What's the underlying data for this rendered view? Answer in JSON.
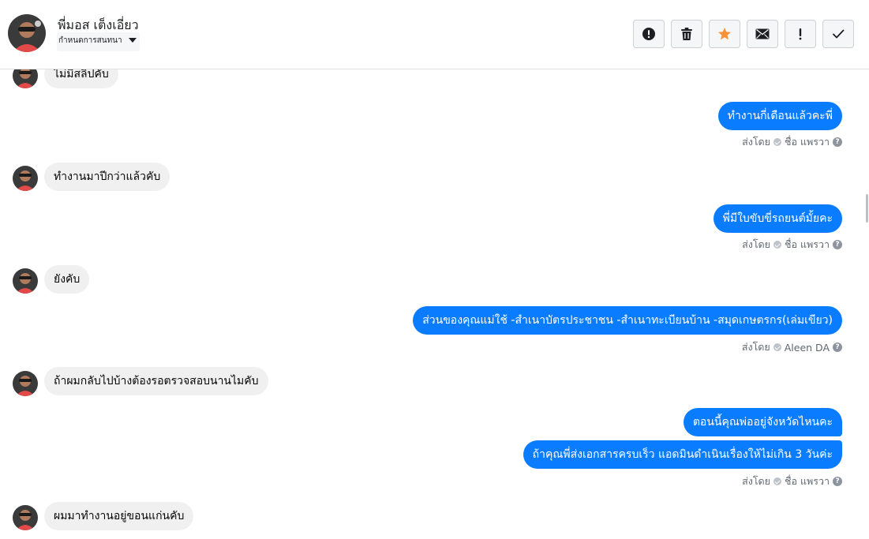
{
  "header": {
    "contact_name": "พี่มอส เต็งเอี่ยว",
    "assign_label": "กำหนดการสนทนา"
  },
  "toolbar": [
    {
      "name": "report-spam-button",
      "icon": "alert-circle-icon"
    },
    {
      "name": "delete-button",
      "icon": "trash-icon"
    },
    {
      "name": "star-button",
      "icon": "star-icon",
      "color": "#f7923b"
    },
    {
      "name": "mark-unread-button",
      "icon": "envelope-icon"
    },
    {
      "name": "follow-up-button",
      "icon": "exclamation-icon"
    },
    {
      "name": "mark-done-button",
      "icon": "checkmark-icon"
    }
  ],
  "messages": [
    {
      "direction": "incoming",
      "text": "ไม่มีสลิปคับ"
    },
    {
      "direction": "outgoing",
      "text": "ทำงานกี่เดือนแล้วคะพี่"
    },
    {
      "direction": "status",
      "text": "ส่งโดย",
      "sender": "ชื่อ แพรวา"
    },
    {
      "direction": "incoming",
      "text": "ทำงานมาปีกว่าแล้วคับ"
    },
    {
      "direction": "outgoing",
      "text": "พี่มีใบขับขี่รถยนต์มั้ยคะ"
    },
    {
      "direction": "status",
      "text": "ส่งโดย",
      "sender": "ชื่อ แพรวา"
    },
    {
      "direction": "incoming",
      "text": "ยังคับ"
    },
    {
      "direction": "outgoing",
      "text": "ส่วนของคุณแม่ใช้  -สำเนาบัตรประชาชน -สำเนาทะเบียนบ้าน -สมุดเกษตรกร(เล่มเขียว)"
    },
    {
      "direction": "status",
      "text": "ส่งโดย",
      "sender": "Aleen DA"
    },
    {
      "direction": "incoming",
      "text": "ถ้าผมกลับไปบ้างต้องรอตรวจสอบนานไมคับ"
    },
    {
      "direction": "outgoing",
      "text": "ตอนนี้คุณพ่ออยู่จังหวัดไหนคะ"
    },
    {
      "direction": "outgoing",
      "text": "ถ้าคุณพี่ส่งเอกสารครบเร็ว แอดมินดำเนินเรื่องให้ไม่เกิน 3 วันค่ะ"
    },
    {
      "direction": "status",
      "text": "ส่งโดย",
      "sender": "ชื่อ แพรวา"
    },
    {
      "direction": "incoming",
      "text": "ผมมาทำงานอยู่ขอนแก่นคับ"
    }
  ],
  "colors": {
    "outgoing_bubble": "#0a7cff",
    "incoming_bubble": "#f0f0f0",
    "star": "#f7923b"
  }
}
